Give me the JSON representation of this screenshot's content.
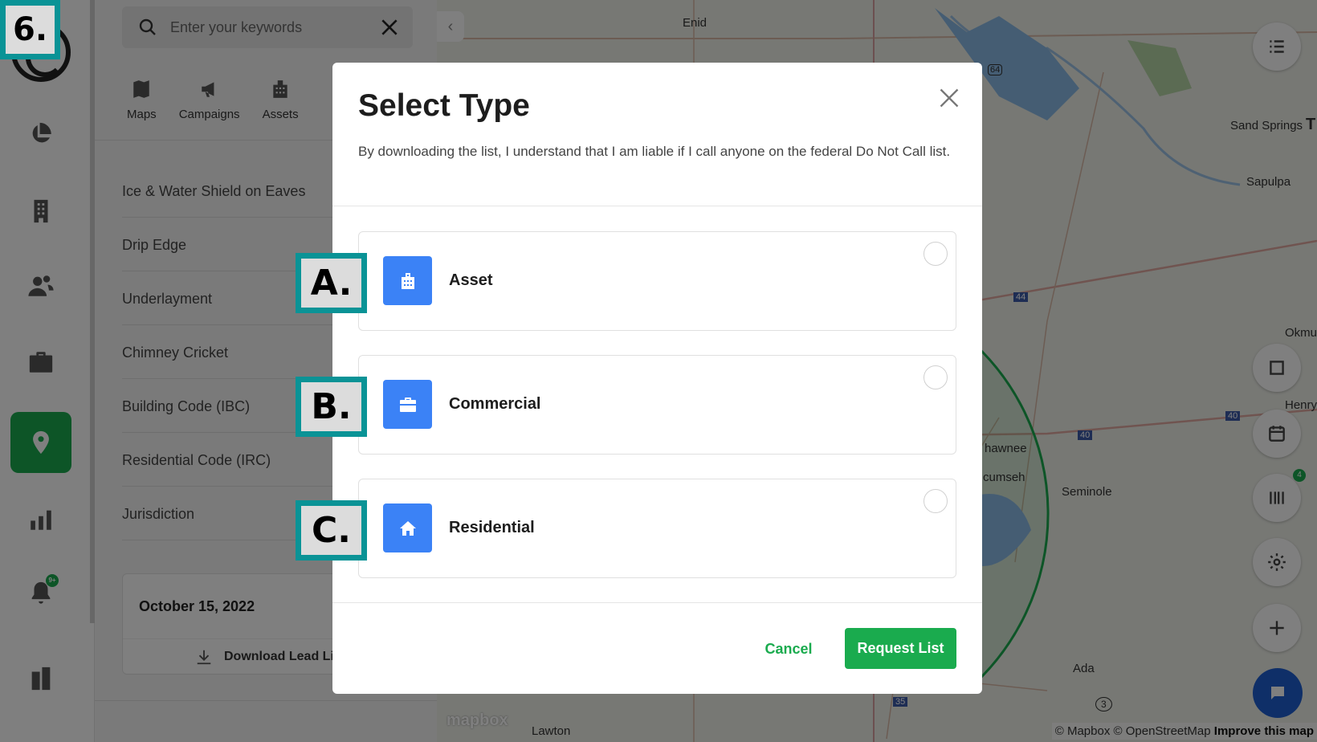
{
  "step_badge": "6.",
  "panel": {
    "search_placeholder": "Enter your keywords",
    "tabs": [
      "Maps",
      "Campaigns",
      "Assets"
    ],
    "list_items": [
      "Ice & Water Shield on Eaves",
      "Drip Edge",
      "Underlayment",
      "Chimney Cricket",
      "Building Code (IBC)",
      "Residential Code (IRC)",
      "Jurisdiction"
    ],
    "date": "October 15, 2022",
    "download_label": "Download Lead List"
  },
  "rail": {
    "icons": [
      "dashboard-icon",
      "building-icon",
      "users-icon",
      "briefcase-icon",
      "map-pin-icon",
      "bar-chart-icon",
      "bell-icon",
      "apartments-icon"
    ],
    "active": "map-pin-icon",
    "notification_badge": "9+"
  },
  "map": {
    "labels": [
      "Enid",
      "Sand Springs",
      "T",
      "Sapulpa",
      "Okmu",
      "Henrye",
      "hawnee",
      "cumseh",
      "Seminole",
      "Ada",
      "Lawton"
    ],
    "highway_shields": [
      "64",
      "44",
      "40",
      "40",
      "35",
      "3"
    ],
    "badge": "4",
    "logo": "mapbox",
    "attribution": "© Mapbox © OpenStreetMap",
    "attribution_link": "Improve this map"
  },
  "modal": {
    "title": "Select Type",
    "description": "By downloading the list, I understand that I am liable if I call anyone on the federal Do Not Call list.",
    "options": [
      {
        "label": "Asset",
        "icon": "asset-building-icon",
        "callout": "A."
      },
      {
        "label": "Commercial",
        "icon": "briefcase-icon",
        "callout": "B."
      },
      {
        "label": "Residential",
        "icon": "house-icon",
        "callout": "C."
      }
    ],
    "cancel_label": "Cancel",
    "submit_label": "Request List"
  },
  "colors": {
    "brand_green": "#1aab4e",
    "option_icon_blue": "#3b82f6",
    "callout_border": "#0a9396",
    "chat_blue": "#1f5fd0"
  }
}
